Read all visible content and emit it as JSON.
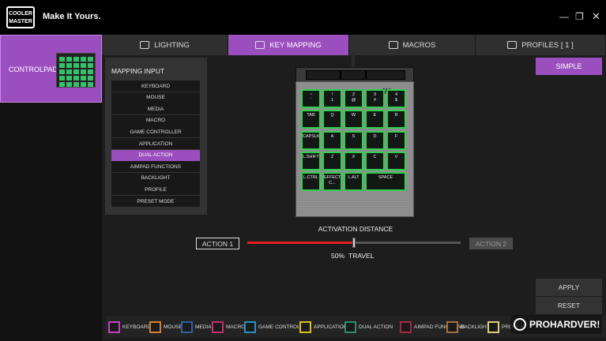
{
  "window": {
    "brand_logo": "COOLER MASTER",
    "tagline": "Make It Yours."
  },
  "device": {
    "name": "CONTROLPAD_G"
  },
  "tabs": [
    {
      "label": "LIGHTING",
      "icon": "bulb-icon"
    },
    {
      "label": "KEY MAPPING",
      "icon": "keyboard-icon",
      "active": true
    },
    {
      "label": "MACROS",
      "icon": "macro-icon"
    },
    {
      "label": "PROFILES [ 1 ]",
      "icon": "profiles-icon"
    }
  ],
  "mapping_input": {
    "title": "MAPPING INPUT",
    "items": [
      "KEYBOARD",
      "MOUSE",
      "MEDIA",
      "MACRO",
      "GAME CONTROLLER",
      "APPLICATION",
      "DUAL ACTION",
      "AIMPAD FUNCTIONS",
      "BACKLIGHT",
      "PROFILE",
      "PRESET MODE"
    ],
    "selected": "DUAL ACTION"
  },
  "keypad": {
    "logo": "///",
    "keys": [
      {
        "top": "~",
        "bottom": "`"
      },
      {
        "top": "!",
        "bottom": "1"
      },
      {
        "top": "2",
        "bottom": "@"
      },
      {
        "top": "3",
        "bottom": "#"
      },
      {
        "top": "4",
        "bottom": "$"
      },
      {
        "top": "TAB",
        "bottom": ""
      },
      {
        "top": "Q",
        "bottom": ""
      },
      {
        "top": "W",
        "bottom": ""
      },
      {
        "top": "E",
        "bottom": ""
      },
      {
        "top": "R",
        "bottom": ""
      },
      {
        "top": "CAPSLK",
        "bottom": ""
      },
      {
        "top": "A",
        "bottom": ""
      },
      {
        "top": "S",
        "bottom": ""
      },
      {
        "top": "D",
        "bottom": ""
      },
      {
        "top": "F",
        "bottom": ""
      },
      {
        "top": "L.SHIFT",
        "bottom": ""
      },
      {
        "top": "Z",
        "bottom": ""
      },
      {
        "top": "X",
        "bottom": ""
      },
      {
        "top": "C",
        "bottom": ""
      },
      {
        "top": "V",
        "bottom": ""
      },
      {
        "top": "L.CTRL",
        "bottom": ""
      },
      {
        "top": "EFFECT",
        "bottom": "C..."
      },
      {
        "top": "L.ALT",
        "bottom": ""
      },
      {
        "top": "SPACE",
        "bottom": ""
      }
    ],
    "key_color": "#2fd04f"
  },
  "mode_button": "SIMPLE",
  "activation": {
    "label": "ACTIVATION DISTANCE",
    "action1": "ACTION 1",
    "action2": "ACTION 2",
    "percent": "50%",
    "travel_label": "TRAVEL",
    "value": 0.5
  },
  "buttons": {
    "apply": "APPLY",
    "reset": "RESET"
  },
  "legend": [
    {
      "label": "KEYBOARD",
      "color": "#c040c0"
    },
    {
      "label": "MOUSE",
      "color": "#d08030"
    },
    {
      "label": "MEDIA",
      "color": "#2f5fa0"
    },
    {
      "label": "MACRO",
      "color": "#c0306a"
    },
    {
      "label": "GAME CONTROLLER",
      "color": "#2a8fc0"
    },
    {
      "label": "APPLICATION",
      "color": "#d8c020"
    },
    {
      "label": "DUAL ACTION",
      "color": "#2f8a6a"
    },
    {
      "label": "AIMPAD FUNCTIONS",
      "color": "#a02a40"
    },
    {
      "label": "BACKLIGHT",
      "color": "#a07040"
    },
    {
      "label": "PROFILE",
      "color": "#d8d080"
    }
  ],
  "watermark": "PROHARDVER!"
}
